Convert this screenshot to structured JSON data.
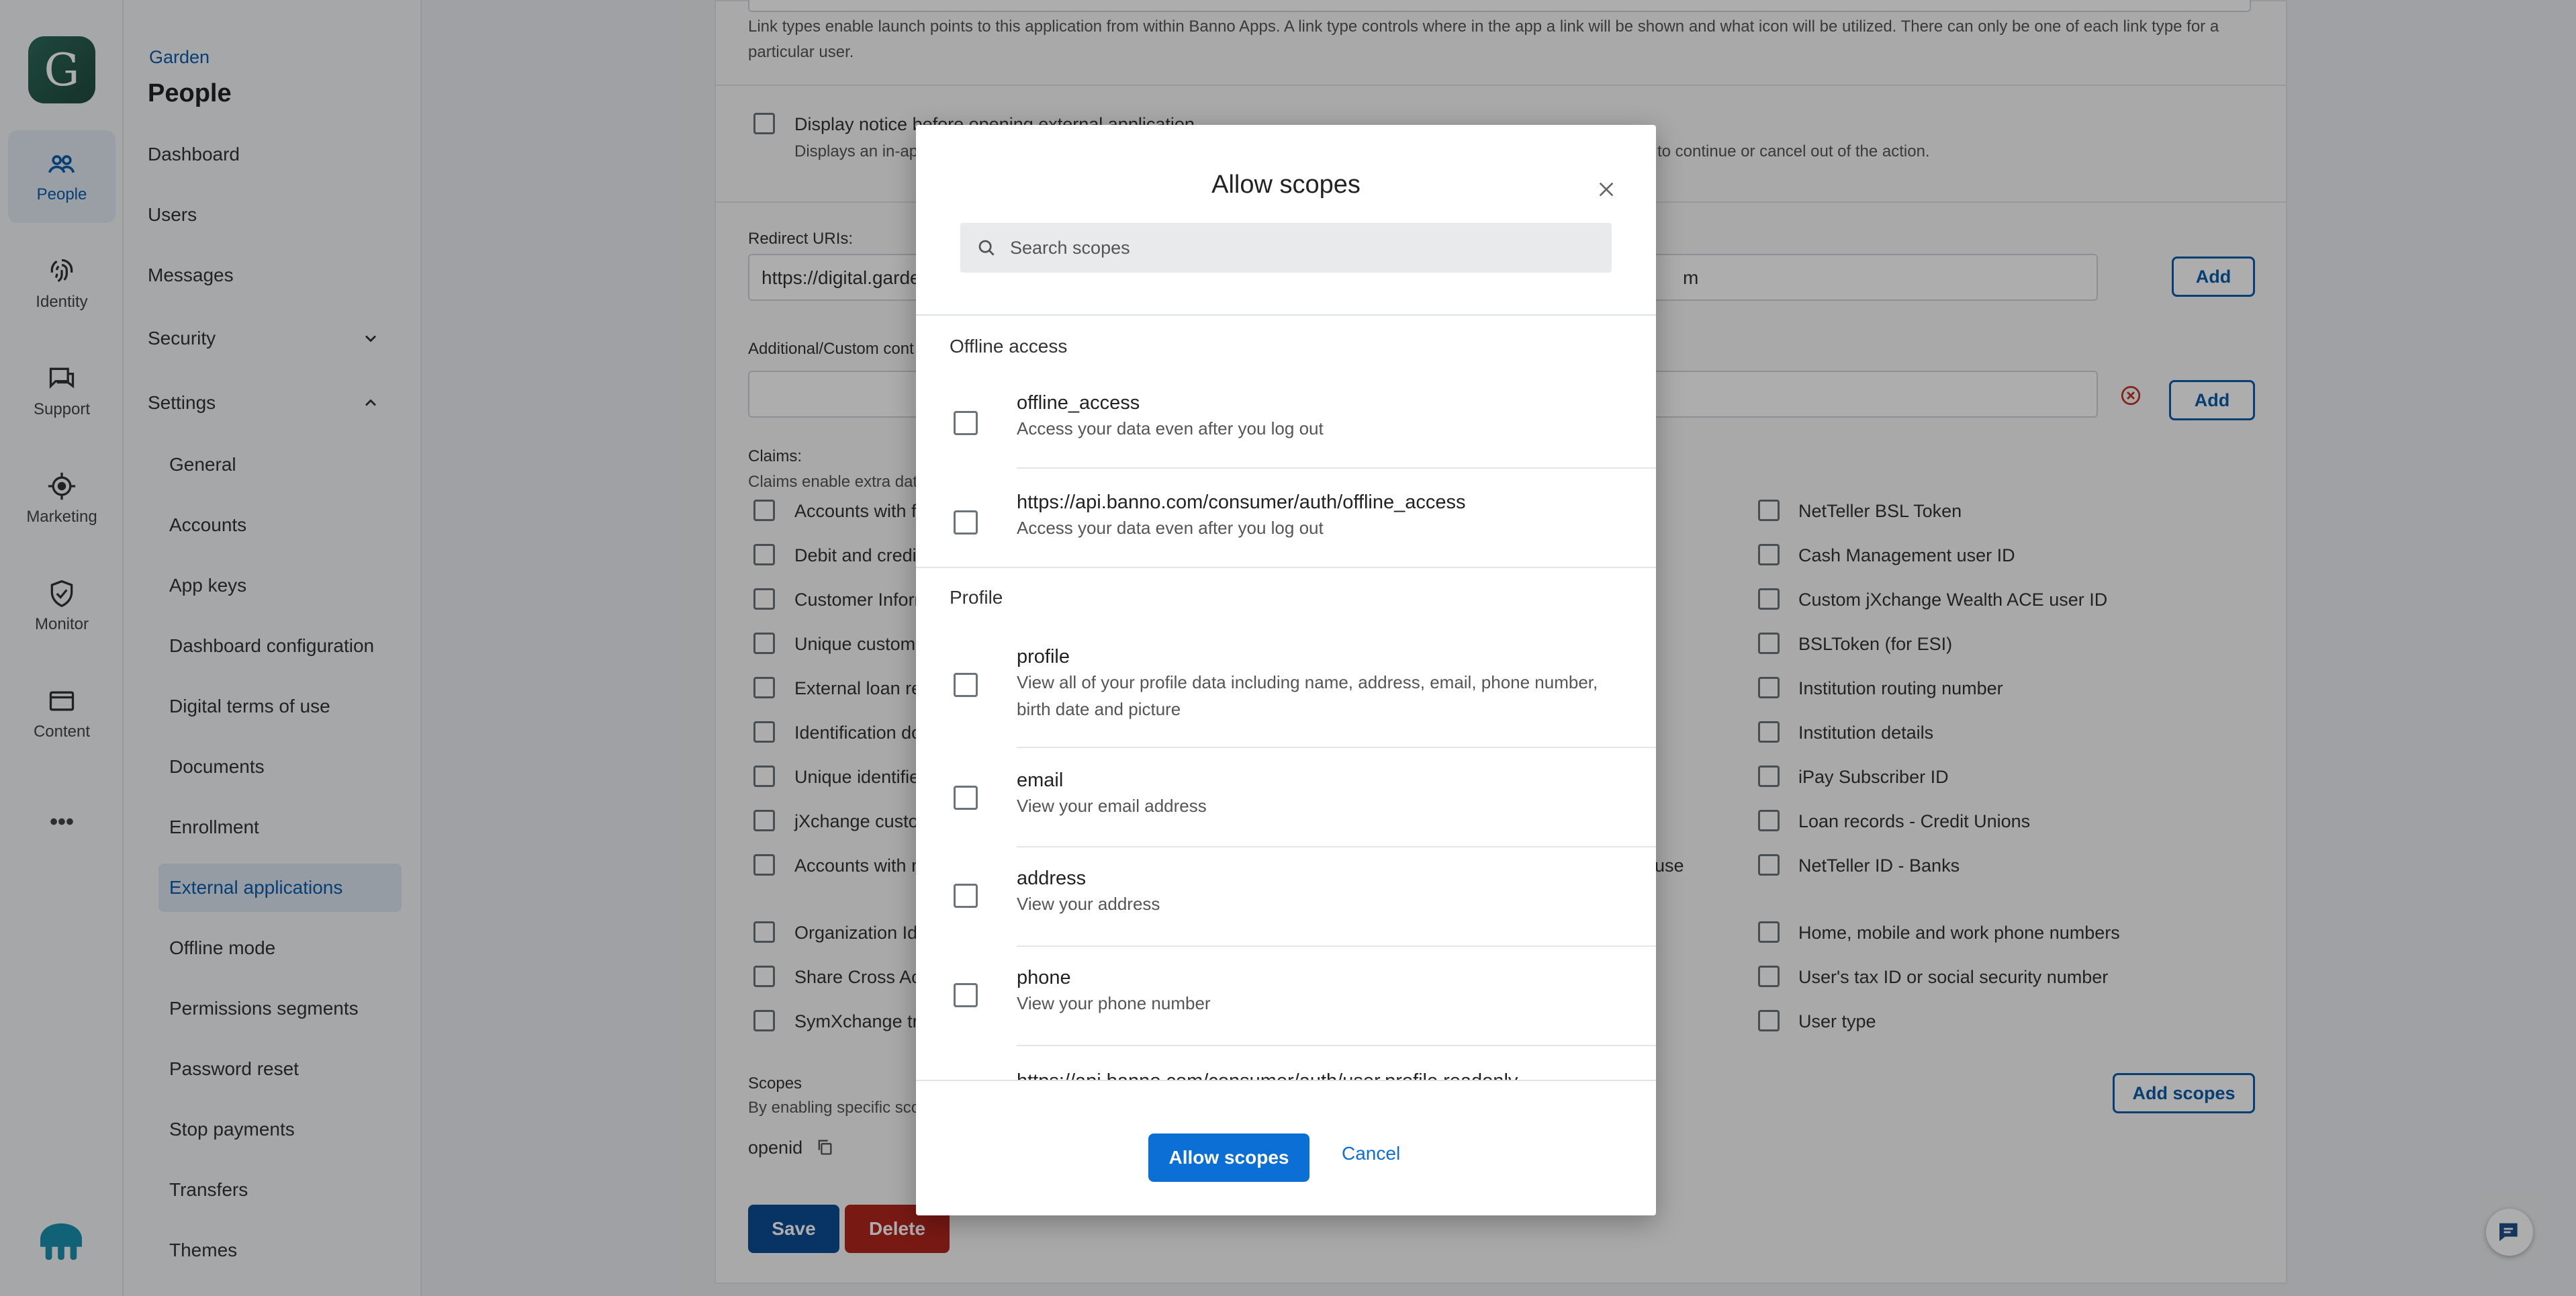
{
  "rail": {
    "logo_letter": "G",
    "items": [
      {
        "label": "People",
        "icon": "people-icon"
      },
      {
        "label": "Identity",
        "icon": "fingerprint-icon"
      },
      {
        "label": "Support",
        "icon": "chat-icon"
      },
      {
        "label": "Marketing",
        "icon": "target-icon"
      },
      {
        "label": "Monitor",
        "icon": "shield-icon"
      },
      {
        "label": "Content",
        "icon": "content-icon"
      }
    ],
    "more": "•••"
  },
  "subnav": {
    "breadcrumb": "Garden",
    "title": "People",
    "items": [
      "Dashboard",
      "Users",
      "Messages",
      "Security",
      "Settings"
    ],
    "settings_items": [
      "General",
      "Accounts",
      "App keys",
      "Dashboard configuration",
      "Digital terms of use",
      "Documents",
      "Enrollment",
      "External applications",
      "Offline mode",
      "Permissions segments",
      "Password reset",
      "Stop payments",
      "Transfers",
      "Themes"
    ]
  },
  "page": {
    "link_types_help": "Link types enable launch points to this application from within Banno Apps. A link type controls where in the app a link will be shown and what icon will be utilized. There can only be one of each link type for a",
    "link_types_help_2": "particular user.",
    "display_notice_label": "Display notice before opening external application",
    "display_notice_help_left": "Displays an in-app",
    "display_notice_help_right": "to continue or cancel out of the action.",
    "redirect_label": "Redirect URIs:",
    "redirect_value_left": "https://digital.garde",
    "redirect_value_right": "m",
    "add_label": "Add",
    "additional_label": "Additional/Custom cont",
    "claims_label": "Claims:",
    "claims_help": "Claims enable extra dat",
    "claims_left": [
      "Accounts with fi",
      "Debit and credit",
      "Customer Inform",
      "Unique custome",
      "External loan re",
      "Identification do",
      "Unique identifie",
      "jXchange custo",
      "Accounts with m",
      "Organization Id",
      "Share Cross Acc",
      "SymXchange tra"
    ],
    "claims_mid_text": "use",
    "claims_right": [
      "NetTeller BSL Token",
      "Cash Management user ID",
      "Custom jXchange Wealth ACE user ID",
      "BSLToken (for ESI)",
      "Institution routing number",
      "Institution details",
      "iPay Subscriber ID",
      "Loan records - Credit Unions",
      "NetTeller ID - Banks",
      "Home, mobile and work phone numbers",
      "User's tax ID or social security number",
      "User type"
    ],
    "scopes_label": "Scopes",
    "scopes_help": "By enabling specific sco",
    "add_scopes_label": "Add scopes",
    "openid": "openid",
    "save_label": "Save",
    "delete_label": "Delete"
  },
  "modal": {
    "title": "Allow scopes",
    "search_placeholder": "Search scopes",
    "sections": [
      {
        "heading": "Offline access",
        "scopes": [
          {
            "name": "offline_access",
            "desc": "Access your data even after you log out"
          },
          {
            "name": "https://api.banno.com/consumer/auth/offline_access",
            "desc": "Access your data even after you log out"
          }
        ]
      },
      {
        "heading": "Profile",
        "scopes": [
          {
            "name": "profile",
            "desc": "View all of your profile data including name, address, email, phone number, birth date and picture"
          },
          {
            "name": "email",
            "desc": "View your email address"
          },
          {
            "name": "address",
            "desc": "View your address"
          },
          {
            "name": "phone",
            "desc": "View your phone number"
          },
          {
            "name": "https://api.banno.com/consumer/auth/user.profile.readonly",
            "desc": ""
          }
        ]
      }
    ],
    "allow_label": "Allow scopes",
    "cancel_label": "Cancel"
  },
  "colors": {
    "accent": "#0b6fd6",
    "brand_dark": "#0b5cab",
    "danger": "#b3261e",
    "save": "#0b4c96"
  }
}
